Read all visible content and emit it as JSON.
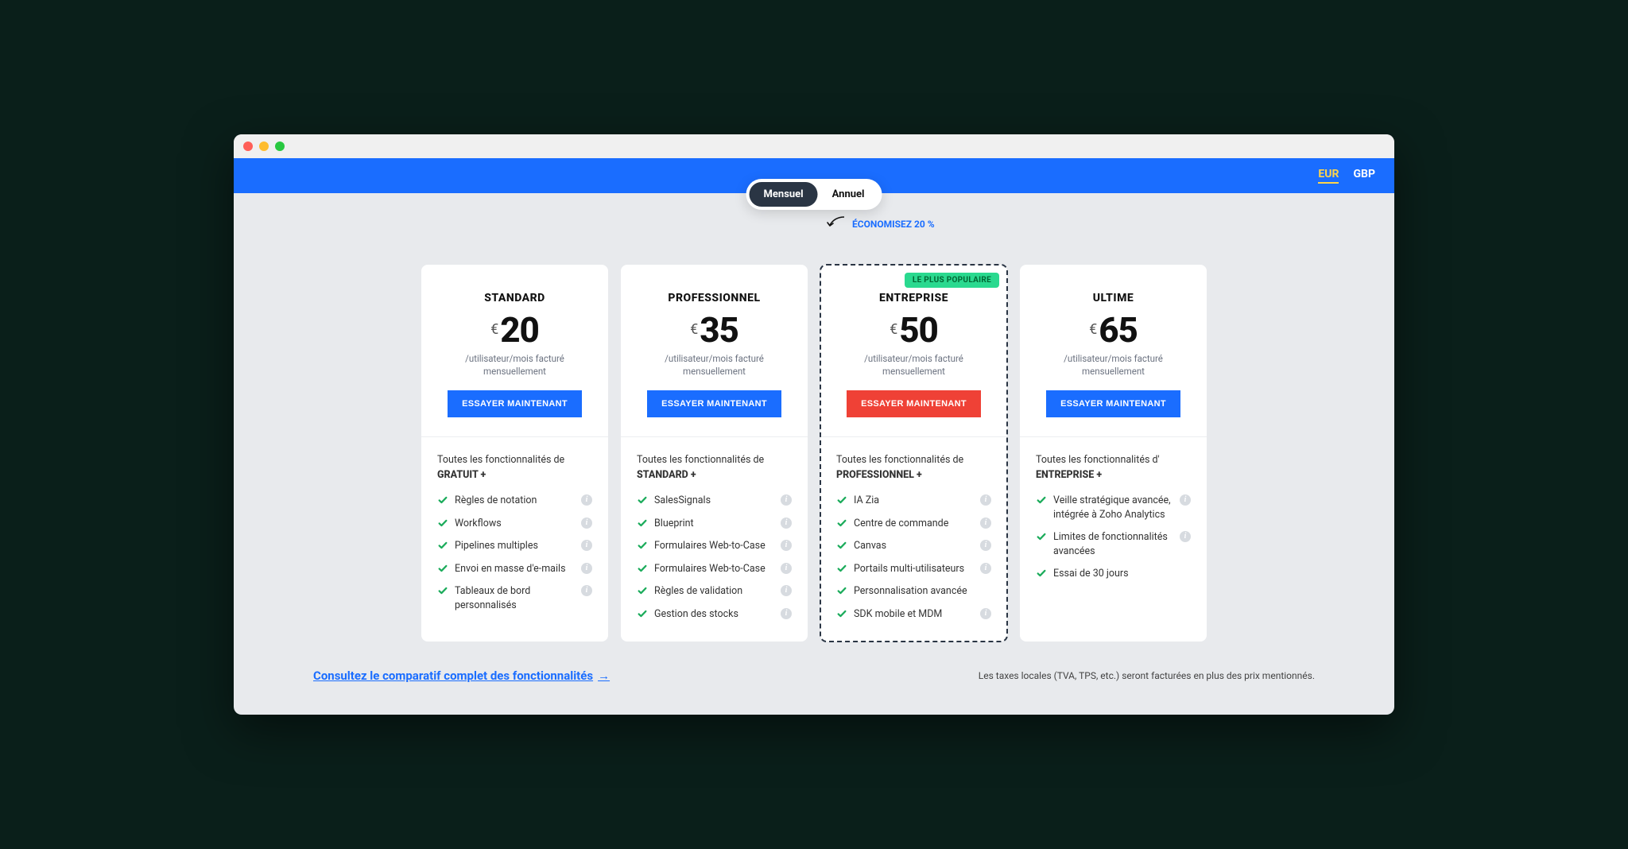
{
  "currencies": [
    {
      "code": "EUR",
      "active": true
    },
    {
      "code": "GBP",
      "active": false
    }
  ],
  "billing_toggle": {
    "monthly": "Mensuel",
    "yearly": "Annuel",
    "active": "monthly"
  },
  "save_note": "ÉCONOMISEZ 20 %",
  "price_sub": "/utilisateur/mois facturé mensuellement",
  "cta_label": "ESSAYER MAINTENANT",
  "inherit_prefix": "Toutes les fonctionnalités de",
  "inherit_prefix_alt": "Toutes les fonctionnalités d'",
  "plans": [
    {
      "name": "STANDARD",
      "currency": "€",
      "amount": "20",
      "inherit": "GRATUIT +",
      "inherit_prefix_key": "inherit_prefix",
      "popular": false,
      "cta_red": false,
      "features": [
        {
          "label": "Règles de notation",
          "info": true
        },
        {
          "label": "Workflows",
          "info": true
        },
        {
          "label": "Pipelines multiples",
          "info": true
        },
        {
          "label": "Envoi en masse d'e-mails",
          "info": true
        },
        {
          "label": "Tableaux de bord personnalisés",
          "info": true
        }
      ]
    },
    {
      "name": "PROFESSIONNEL",
      "currency": "€",
      "amount": "35",
      "inherit": "STANDARD +",
      "inherit_prefix_key": "inherit_prefix",
      "popular": false,
      "cta_red": false,
      "features": [
        {
          "label": "SalesSignals",
          "info": true
        },
        {
          "label": "Blueprint",
          "info": true
        },
        {
          "label": "Formulaires Web-to-Case",
          "info": true
        },
        {
          "label": "Formulaires Web-to-Case",
          "info": true
        },
        {
          "label": "Règles de validation",
          "info": true
        },
        {
          "label": "Gestion des stocks",
          "info": true
        }
      ]
    },
    {
      "name": "ENTREPRISE",
      "currency": "€",
      "amount": "50",
      "inherit": "PROFESSIONNEL +",
      "inherit_prefix_key": "inherit_prefix",
      "popular": true,
      "popular_label": "LE PLUS POPULAIRE",
      "cta_red": true,
      "features": [
        {
          "label": "IA Zia",
          "info": true
        },
        {
          "label": "Centre de commande",
          "info": true
        },
        {
          "label": "Canvas",
          "info": true
        },
        {
          "label": "Portails multi-utilisateurs",
          "info": true
        },
        {
          "label": "Personnalisation avancée",
          "info": false
        },
        {
          "label": "SDK mobile et MDM",
          "info": true
        }
      ]
    },
    {
      "name": "ULTIME",
      "currency": "€",
      "amount": "65",
      "inherit": "ENTREPRISE +",
      "inherit_prefix_key": "inherit_prefix_alt",
      "popular": false,
      "cta_red": false,
      "features": [
        {
          "label": "Veille stratégique avancée, intégrée à Zoho Analytics",
          "info": true
        },
        {
          "label": "Limites de fonctionnalités avancées",
          "info": true
        },
        {
          "label": "Essai de 30 jours",
          "info": false
        }
      ]
    }
  ],
  "compare_link": "Consultez le comparatif complet des fonctionnalités",
  "tax_note": "Les taxes locales (TVA, TPS, etc.) seront facturées en plus des prix mentionnés."
}
